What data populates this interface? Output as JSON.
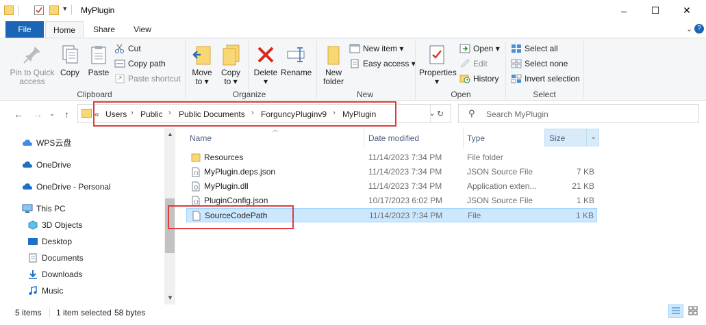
{
  "window": {
    "title": "MyPlugin",
    "controls": {
      "minimize": "–",
      "maximize": "☐",
      "close": "✕"
    }
  },
  "tabs": [
    {
      "label": "File"
    },
    {
      "label": "Home"
    },
    {
      "label": "Share"
    },
    {
      "label": "View"
    }
  ],
  "ribbon": {
    "clipboard": {
      "pin": "Pin to Quick access",
      "pin_l1": "Pin to Quick",
      "pin_l2": "access",
      "copy": "Copy",
      "paste": "Paste",
      "cut": "Cut",
      "copy_path": "Copy path",
      "paste_shortcut": "Paste shortcut",
      "label": "Clipboard"
    },
    "organize": {
      "move_to_l1": "Move",
      "move_to_l2": "to",
      "copy_to_l1": "Copy",
      "copy_to_l2": "to",
      "delete": "Delete",
      "rename": "Rename",
      "label": "Organize"
    },
    "new": {
      "new_folder_l1": "New",
      "new_folder_l2": "folder",
      "new_item": "New item",
      "easy_access": "Easy access",
      "label": "New"
    },
    "open": {
      "properties": "Properties",
      "open": "Open",
      "edit": "Edit",
      "history": "History",
      "label": "Open"
    },
    "select": {
      "select_all": "Select all",
      "select_none": "Select none",
      "invert": "Invert selection",
      "label": "Select"
    }
  },
  "address": {
    "overflow": "«",
    "crumbs": [
      "Users",
      "Public",
      "Public Documents",
      "ForguncyPluginv9",
      "MyPlugin"
    ],
    "search_placeholder": "Search MyPlugin"
  },
  "navpane": [
    {
      "label": "WPS云盘",
      "icon": "cloud-icon"
    },
    {
      "label": "OneDrive",
      "icon": "onedrive-icon"
    },
    {
      "label": "OneDrive - Personal",
      "icon": "onedrive-icon"
    },
    {
      "label": "This PC",
      "icon": "computer-icon"
    },
    {
      "label": "3D Objects",
      "icon": "cube-icon"
    },
    {
      "label": "Desktop",
      "icon": "desktop-icon"
    },
    {
      "label": "Documents",
      "icon": "documents-icon"
    },
    {
      "label": "Downloads",
      "icon": "download-icon"
    },
    {
      "label": "Music",
      "icon": "music-icon"
    }
  ],
  "columns": {
    "name": "Name",
    "date": "Date modified",
    "type": "Type",
    "size": "Size"
  },
  "files": [
    {
      "name": "Resources",
      "date": "11/14/2023 7:34 PM",
      "type": "File folder",
      "size": "",
      "icon": "folder-icon"
    },
    {
      "name": "MyPlugin.deps.json",
      "date": "11/14/2023 7:34 PM",
      "type": "JSON Source File",
      "size": "7 KB",
      "icon": "json-file-icon"
    },
    {
      "name": "MyPlugin.dll",
      "date": "11/14/2023 7:34 PM",
      "type": "Application exten...",
      "size": "21 KB",
      "icon": "dll-file-icon"
    },
    {
      "name": "PluginConfig.json",
      "date": "10/17/2023 6:02 PM",
      "type": "JSON Source File",
      "size": "1 KB",
      "icon": "json-file-icon"
    },
    {
      "name": "SourceCodePath",
      "date": "11/14/2023 7:34 PM",
      "type": "File",
      "size": "1 KB",
      "icon": "file-icon",
      "selected": true
    }
  ],
  "status": {
    "items": "5 items",
    "selected": "1 item selected",
    "bytes": "58 bytes"
  },
  "colors": {
    "accent": "#1a66b4",
    "selection": "#cce8ff",
    "highlight": "#e03a3a",
    "folder": "#f8d775"
  }
}
